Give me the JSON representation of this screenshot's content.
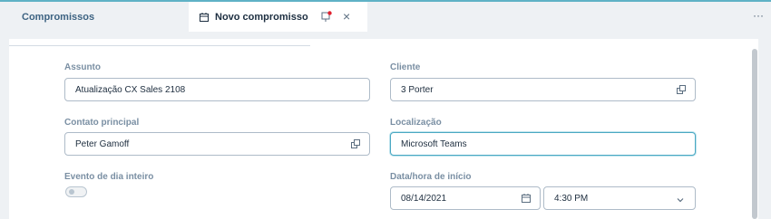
{
  "tabs": {
    "left_label": "Compromissos",
    "active_label": "Novo compromisso",
    "close_glyph": "×",
    "more_glyph": "···"
  },
  "form": {
    "assunto": {
      "label": "Assunto",
      "value": "Atualização CX Sales 2108"
    },
    "cliente": {
      "label": "Cliente",
      "value": "3 Porter"
    },
    "contato": {
      "label": "Contato principal",
      "value": "Peter Gamoff"
    },
    "localizacao": {
      "label": "Localização",
      "value": "Microsoft Teams"
    },
    "evento_dia": {
      "label": "Evento de dia inteiro",
      "checked": false
    },
    "inicio": {
      "label": "Data/hora de início",
      "date": "08/14/2021",
      "time": "4:30 PM"
    }
  },
  "colors": {
    "accent": "#5fb2c6",
    "focus": "#4aa8c2",
    "label": "#7a8fa3"
  },
  "icons": [
    "calendar-icon",
    "pin-icon",
    "close-icon",
    "more-icon",
    "open-link-icon",
    "chevron-down-icon"
  ]
}
